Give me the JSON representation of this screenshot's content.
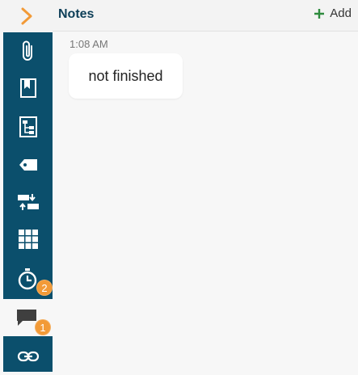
{
  "header": {
    "title": "Notes",
    "add_label": "Add"
  },
  "note": {
    "time": "1:08 AM",
    "text": "not finished"
  },
  "rail": {
    "items": [
      {
        "icon": "paperclip-icon"
      },
      {
        "icon": "bookmark-icon"
      },
      {
        "icon": "hierarchy-icon"
      },
      {
        "icon": "tag-icon"
      },
      {
        "icon": "swap-icon"
      },
      {
        "icon": "grid-icon"
      },
      {
        "icon": "timer-icon",
        "badge": "2"
      },
      {
        "icon": "comment-icon",
        "badge": "1",
        "active": true
      },
      {
        "icon": "link-icon"
      }
    ]
  },
  "colors": {
    "rail": "#0b4f6c",
    "accent": "#f29a37",
    "title": "#0e3f58",
    "add": "#2e8b3e"
  }
}
